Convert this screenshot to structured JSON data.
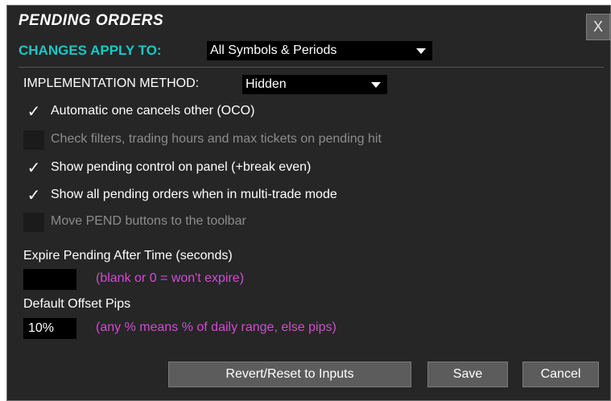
{
  "dialog": {
    "title": "PENDING ORDERS",
    "close_label": "X"
  },
  "apply_to": {
    "label": "CHANGES APPLY TO:",
    "selected": "All Symbols & Periods"
  },
  "implementation": {
    "label": "IMPLEMENTATION METHOD:",
    "selected": "Hidden"
  },
  "options": [
    {
      "label": "Automatic one cancels other (OCO)",
      "checked": true,
      "enabled": true
    },
    {
      "label": "Check filters, trading hours and max tickets on pending hit",
      "checked": false,
      "enabled": false
    },
    {
      "label": "Show pending control on panel (+break even)",
      "checked": true,
      "enabled": true
    },
    {
      "label": "Show all pending orders when in multi-trade mode",
      "checked": true,
      "enabled": true
    },
    {
      "label": "Move PEND buttons to the toolbar",
      "checked": false,
      "enabled": false
    }
  ],
  "check_glyph": "✓",
  "expire": {
    "label": "Expire Pending After Time (seconds)",
    "value": "",
    "hint": "(blank or 0 = won't expire)"
  },
  "offset": {
    "label": "Default Offset Pips",
    "value": "10%",
    "hint": "(any % means % of daily range, else pips)"
  },
  "buttons": {
    "revert": "Revert/Reset to Inputs",
    "save": "Save",
    "cancel": "Cancel"
  },
  "colors": {
    "background": "#262626",
    "accent_cyan": "#19c7c7",
    "hint_magenta": "#d24bd2",
    "disabled_text": "#8c8c8c"
  }
}
